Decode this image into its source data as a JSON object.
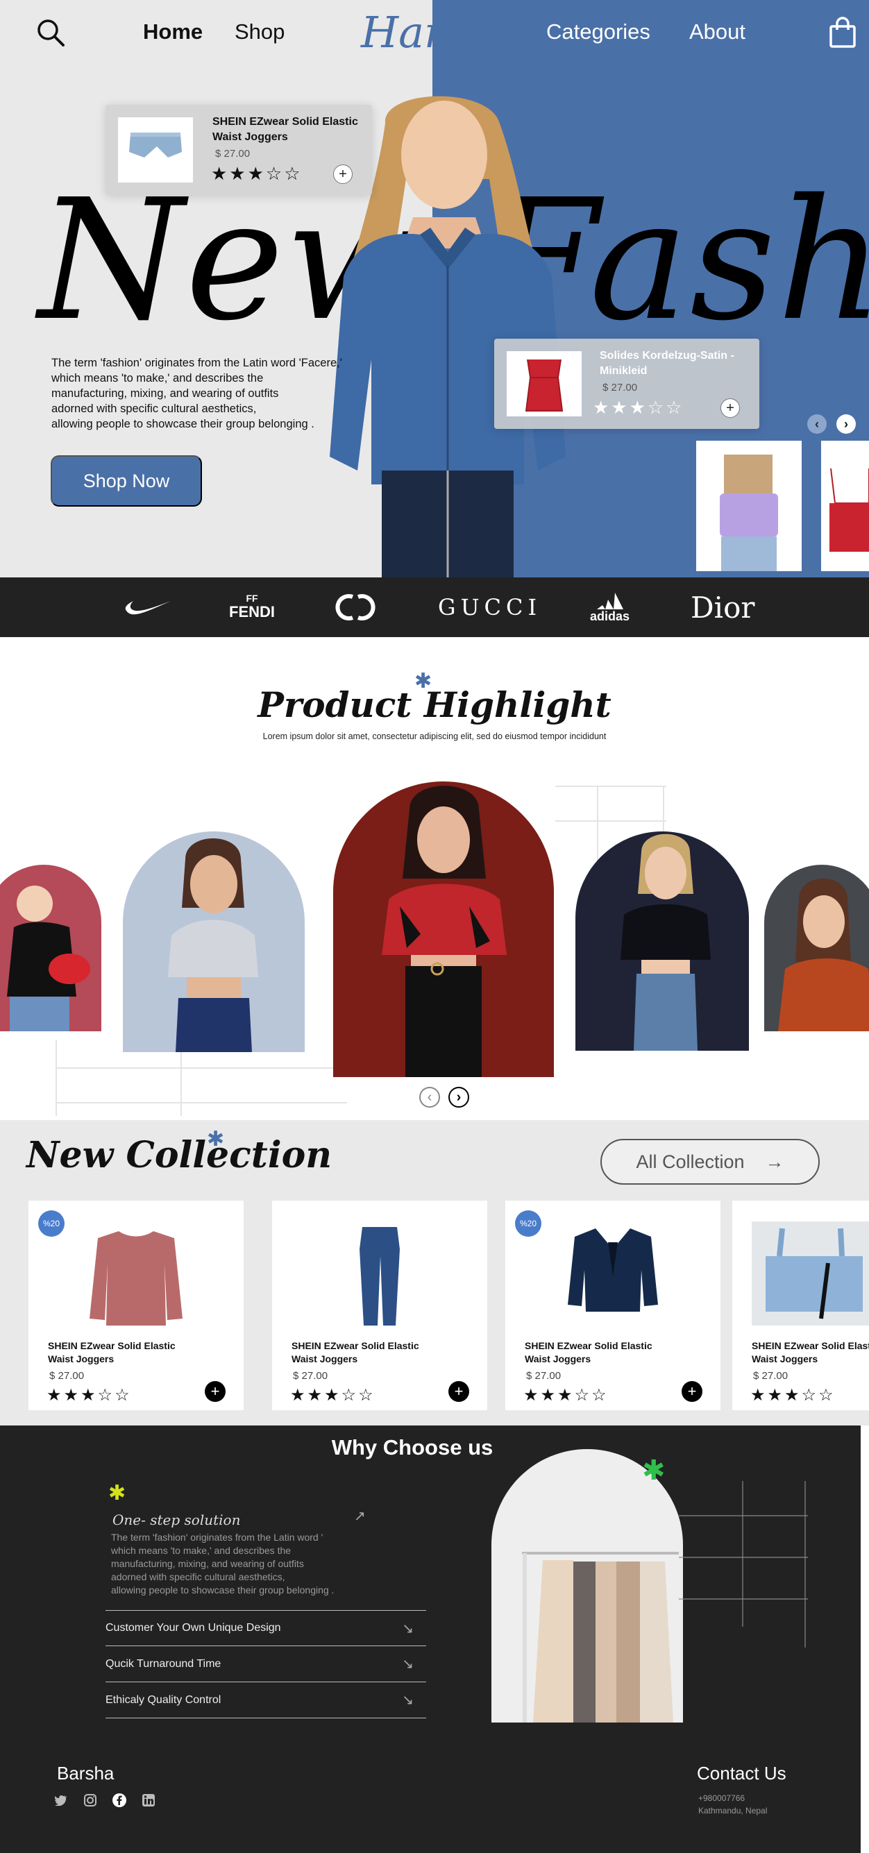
{
  "nav": {
    "home": "Home",
    "shop": "Shop",
    "brand": "Hanger",
    "categories": "Categories",
    "about": "About"
  },
  "hero": {
    "headline": "New Fashion",
    "description": "The term 'fashion' originates from the Latin word 'Facere,'\nwhich means 'to make,' and describes the\n manufacturing, mixing, and wearing of outfits\nadorned with specific cultural aesthetics,\nallowing people to showcase their group belonging .",
    "cta": "Shop Now",
    "card1": {
      "title": "SHEIN EZwear Solid  Elastic Waist Joggers",
      "price": "$ 27.00",
      "stars": "★★★☆☆",
      "add": "+"
    },
    "card2": {
      "title": "Solides Kordelzug-Satin -Minikleid",
      "price": "$ 27.00",
      "stars": "★★★☆☆",
      "add": "+"
    },
    "prev": "‹",
    "next": "›"
  },
  "brands": [
    "FENDI",
    "GUCCI",
    "adidas",
    "Dior"
  ],
  "highlight": {
    "title": "Product Highlight",
    "subtitle": "Lorem ipsum dolor sit amet, consectetur adipiscing elit, sed do eiusmod tempor incididunt",
    "prev": "‹",
    "next": "›"
  },
  "collection": {
    "title": "New Collection",
    "all_button": "All Collection",
    "arrow": "→",
    "products": [
      {
        "badge": "%20",
        "name": "SHEIN EZwear Solid  Elastic Waist Joggers",
        "price": "$ 27.00",
        "stars": "★★★☆☆",
        "add": "+"
      },
      {
        "badge": "",
        "name": "SHEIN EZwear Solid  Elastic Waist Joggers",
        "price": "$ 27.00",
        "stars": "★★★☆☆",
        "add": "+"
      },
      {
        "badge": "%20",
        "name": "SHEIN EZwear Solid  Elastic Waist Joggers",
        "price": "$ 27.00",
        "stars": "★★★☆☆",
        "add": "+"
      },
      {
        "badge": "",
        "name": "SHEIN EZwear Solid  Elastic Waist Joggers",
        "price": "$ 27.00",
        "stars": "★★★☆☆",
        "add": ""
      }
    ]
  },
  "why": {
    "title": "Why Choose us",
    "one_step": "One- step solution",
    "description": "The term 'fashion' originates from the Latin word '\nwhich means 'to make,' and describes the\n manufacturing, mixing, and wearing of outfits\nadorned with specific cultural aesthetics,\nallowing people to showcase their group belonging .",
    "items": [
      "Customer Your Own Unique Design",
      "Qucik Turnaround Time",
      "Ethicaly Quality Control"
    ],
    "item_arrow": "↘",
    "one_step_arrow": "↗"
  },
  "footer": {
    "name": "Barsha",
    "contact_title": "Contact Us",
    "phone": "+980007766",
    "address": "Kathmandu, Nepal"
  },
  "colors": {
    "accent_blue": "#4a70a8",
    "dark": "#222222",
    "light_gray": "#e9e9e9",
    "badge_blue": "#4a7ccc"
  }
}
